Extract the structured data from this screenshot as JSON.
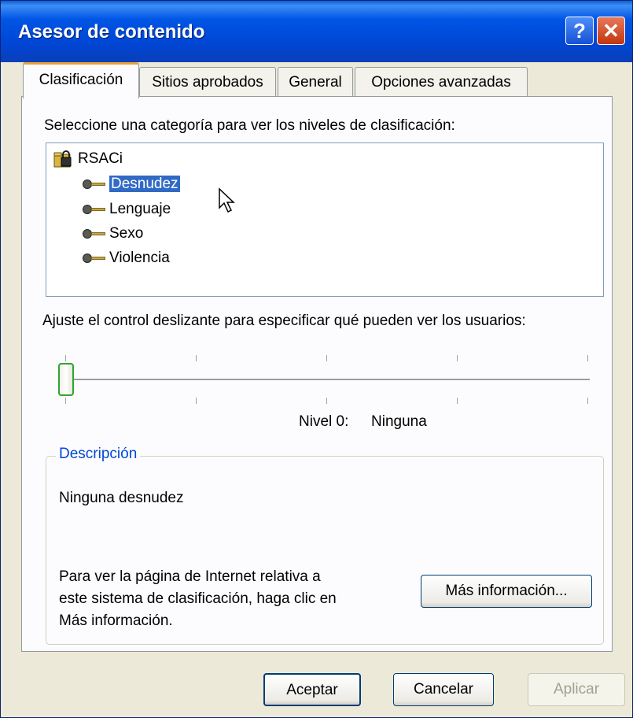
{
  "window": {
    "title": "Asesor de contenido"
  },
  "titlebar_buttons": {
    "help": "?",
    "close": "✕"
  },
  "tabs": [
    {
      "label": "Clasificación",
      "active": true
    },
    {
      "label": "Sitios aprobados",
      "active": false
    },
    {
      "label": "General",
      "active": false
    },
    {
      "label": "Opciones avanzadas",
      "active": false
    }
  ],
  "panel": {
    "category_prompt": "Seleccione una categoría para ver los niveles de clasificación:",
    "tree": {
      "root": {
        "label": "RSACi",
        "icon": "ratings-folder-icon"
      },
      "items": [
        {
          "label": "Desnudez",
          "icon": "key-icon",
          "selected": true
        },
        {
          "label": "Lenguaje",
          "icon": "key-icon",
          "selected": false
        },
        {
          "label": "Sexo",
          "icon": "key-icon",
          "selected": false
        },
        {
          "label": "Violencia",
          "icon": "key-icon",
          "selected": false
        }
      ]
    },
    "slider_prompt": "Ajuste el control deslizante para especificar qué pueden ver los usuarios:",
    "slider": {
      "level_label": "Nivel 0:",
      "level_name": "Ninguna",
      "value": 0,
      "max": 4
    },
    "description": {
      "legend": "Descripción",
      "text": "Ninguna desnudez",
      "info_line1": "Para ver la página de Internet relativa a",
      "info_line2": "este sistema de clasificación, haga clic en",
      "info_line3": "Más información.",
      "more_info_button": "Más información..."
    }
  },
  "footer": {
    "ok": "Aceptar",
    "cancel": "Cancelar",
    "apply": "Aplicar"
  },
  "colors": {
    "titlebar": "#0055e5",
    "selection": "#316ac5",
    "tab_highlight": "#e6a23c",
    "group_legend": "#0046d5"
  }
}
